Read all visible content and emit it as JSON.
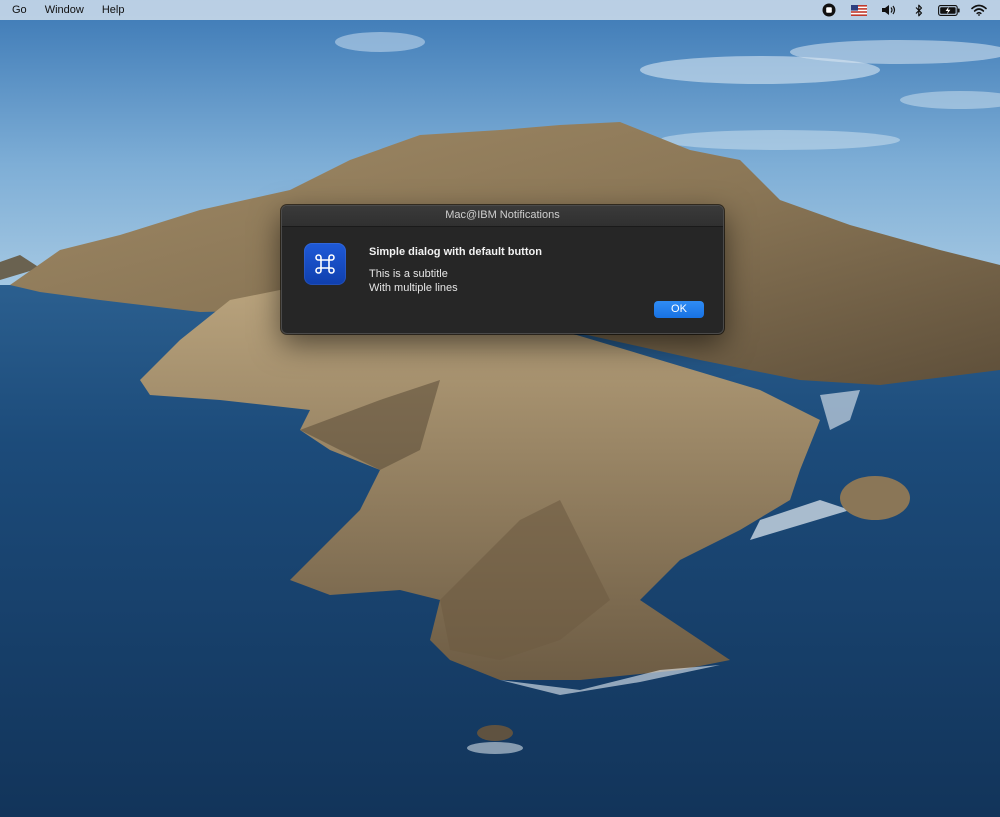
{
  "menubar": {
    "items": [
      {
        "label": "Go"
      },
      {
        "label": "Window"
      },
      {
        "label": "Help"
      }
    ],
    "status_icons": [
      "record-icon",
      "us-flag-icon",
      "volume-icon",
      "bluetooth-icon",
      "battery-charging-icon",
      "wifi-icon"
    ]
  },
  "dialog": {
    "window_title": "Mac@IBM Notifications",
    "icon": "command-key-icon",
    "title": "Simple dialog with default button",
    "subtitle_line1": "This is a subtitle",
    "subtitle_line2": "With multiple lines",
    "ok_label": "OK"
  },
  "colors": {
    "dialog_background": "#262626",
    "accent_blue": "#1f7ae8",
    "icon_blue": "#1a4fcc"
  }
}
